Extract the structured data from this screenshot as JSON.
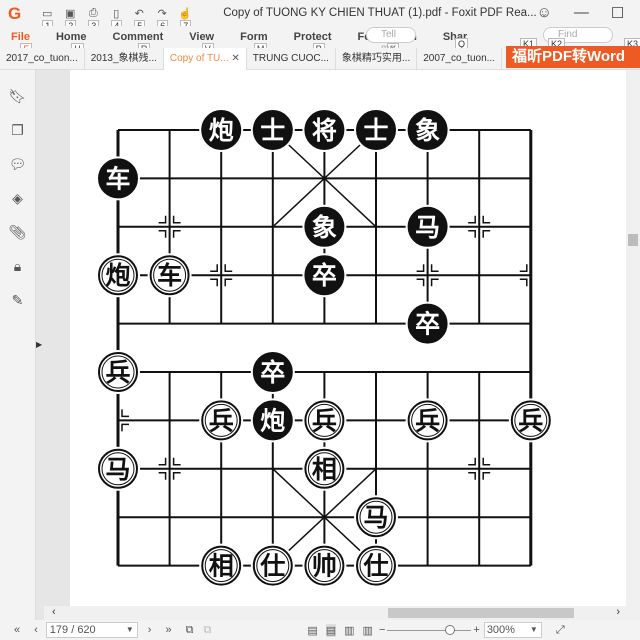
{
  "titlebar": {
    "title": "Copy of TUONG KY CHIEN THUAT (1).pdf - Foxit PDF Rea...",
    "quick_access": [
      "1",
      "2",
      "3",
      "4",
      "5",
      "6",
      "7"
    ]
  },
  "menu": [
    {
      "label": "File",
      "key": "F"
    },
    {
      "label": "Home",
      "key": "H"
    },
    {
      "label": "Comment",
      "key": "R"
    },
    {
      "label": "View",
      "key": "V"
    },
    {
      "label": "Form",
      "key": "M"
    },
    {
      "label": "Protect",
      "key": "P"
    },
    {
      "label": "Foxit eSign",
      "key": "X"
    },
    {
      "label": "Shar",
      "key": "S"
    }
  ],
  "search": {
    "tell_me": "Tell me.",
    "tell_key": "Q",
    "find": "Find",
    "keys": [
      "K1",
      "K2",
      "K3"
    ]
  },
  "tabs": [
    {
      "label": "2017_co_tuon..."
    },
    {
      "label": "2013_象棋残..."
    },
    {
      "label": "Copy of TU...",
      "active": true
    },
    {
      "label": "TRUNG CUOC..."
    },
    {
      "label": "象棋精巧实用..."
    },
    {
      "label": "2007_co_tuon..."
    }
  ],
  "promo": "福昕PDF转Word",
  "status": {
    "page": "179 / 620",
    "zoom": "300%"
  },
  "board": {
    "pieces": [
      {
        "c": "炮",
        "side": "black",
        "col": 2,
        "row": 0
      },
      {
        "c": "士",
        "side": "black",
        "col": 3,
        "row": 0
      },
      {
        "c": "将",
        "side": "black",
        "col": 4,
        "row": 0
      },
      {
        "c": "士",
        "side": "black",
        "col": 5,
        "row": 0
      },
      {
        "c": "象",
        "side": "black",
        "col": 6,
        "row": 0
      },
      {
        "c": "车",
        "side": "black",
        "col": 0,
        "row": 1
      },
      {
        "c": "象",
        "side": "black",
        "col": 4,
        "row": 2
      },
      {
        "c": "马",
        "side": "black",
        "col": 6,
        "row": 2
      },
      {
        "c": "卒",
        "side": "black",
        "col": 4,
        "row": 3
      },
      {
        "c": "卒",
        "side": "black",
        "col": 6,
        "row": 4
      },
      {
        "c": "卒",
        "side": "black",
        "col": 3,
        "row": 5
      },
      {
        "c": "炮",
        "side": "black",
        "col": 3,
        "row": 6
      },
      {
        "c": "炮",
        "side": "red",
        "col": 0,
        "row": 3
      },
      {
        "c": "车",
        "side": "red",
        "col": 1,
        "row": 3
      },
      {
        "c": "兵",
        "side": "red",
        "col": 0,
        "row": 5
      },
      {
        "c": "兵",
        "side": "red",
        "col": 2,
        "row": 6
      },
      {
        "c": "兵",
        "side": "red",
        "col": 4,
        "row": 6
      },
      {
        "c": "兵",
        "side": "red",
        "col": 6,
        "row": 6
      },
      {
        "c": "兵",
        "side": "red",
        "col": 8,
        "row": 6
      },
      {
        "c": "马",
        "side": "red",
        "col": 0,
        "row": 7
      },
      {
        "c": "相",
        "side": "red",
        "col": 4,
        "row": 7
      },
      {
        "c": "马",
        "side": "red",
        "col": 5,
        "row": 8
      },
      {
        "c": "相",
        "side": "red",
        "col": 2,
        "row": 9
      },
      {
        "c": "仕",
        "side": "red",
        "col": 3,
        "row": 9
      },
      {
        "c": "帅",
        "side": "red",
        "col": 4,
        "row": 9
      },
      {
        "c": "仕",
        "side": "red",
        "col": 5,
        "row": 9
      }
    ]
  }
}
